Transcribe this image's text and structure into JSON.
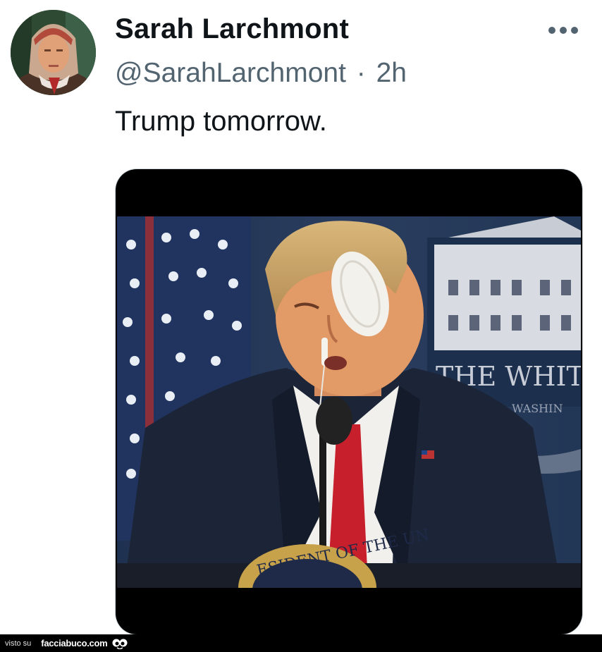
{
  "tweet": {
    "display_name": "Sarah Larchmont",
    "handle": "@SarahLarchmont",
    "separator": "·",
    "time": "2h",
    "text": "Trump tomorrow.",
    "more_icon": "more-horizontal-icon"
  },
  "media": {
    "backdrop_text_line1": "THE WHIT",
    "backdrop_text_line2": "WASHIN",
    "seal_text": "ESIDENT OF THE UN"
  },
  "footer": {
    "visto_label": "visto su",
    "site_label": "facciabuco.com",
    "logo_icon": "facciabuco-eyes-icon"
  },
  "colors": {
    "name": "#0f1419",
    "secondary": "#536471",
    "background": "#ffffff",
    "footer": "#000000"
  }
}
